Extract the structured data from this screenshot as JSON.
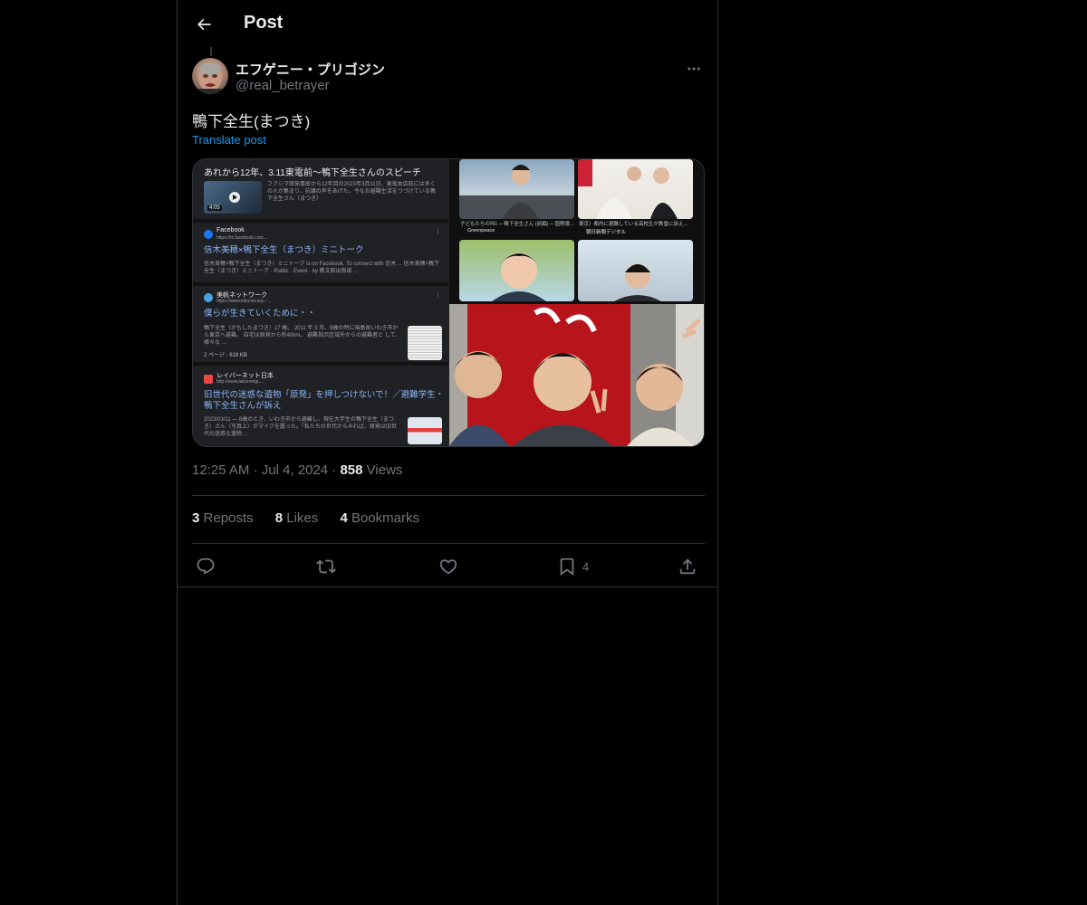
{
  "header": {
    "title": "Post",
    "back_icon": "arrow-left-icon"
  },
  "author": {
    "display_name": "エフゲニー・プリゴジン",
    "handle": "@real_betrayer"
  },
  "post": {
    "text": "鴨下全生(まつき)",
    "translate_label": "Translate post",
    "time": "12:25 AM",
    "date": "Jul 4, 2024",
    "views_count": "858",
    "views_label": "Views"
  },
  "media": {
    "results": [
      {
        "title": "あれから12年、3.11東電前〜鴨下全生さんのスピーチ",
        "snippet": "フクシマ原発事故から12年目の2023年3月11日、東電本店前には多くの人が集まり、抗議の声をあげた。今なお避難生活をつづけている鴨下全生さん（まつき）",
        "duration": "4:05"
      },
      {
        "site": "Facebook",
        "url": "https://m.facebook.com...",
        "link": "信木美穂×鴨下全生（まつき）ミニトーク",
        "snippet": "信木美穂×鴨下全生（まつき）ミニトーク is on Facebook. To connect with 信木 ... 信木美穂×鴨下全生（まつき）ミニトーク · Public · Event · by 教文館出版部 ..."
      },
      {
        "site": "美帆ネットワーク",
        "url": "https://www.kibonet.org › ...",
        "link": "僕らが生きていくために・・",
        "snippet": "鴨下全生（かもしたまつき）17 歳。 2011 年 3 月、8歳の時に福島県いわき市から東京へ避難。 自宅は原発から約40km。 避難指示区域外からの避難者と して、様々な ...",
        "meta": "2 ページ · 619 KB"
      },
      {
        "site": "レイバーネット日本",
        "url": "http://www.labornetjp....",
        "link": "旧世代の迷惑な遺物「原発」を押しつけないで！／避難学生・鴨下全生さんが訴え",
        "snippet": "2023/03/11 — 8歳のとき、いわき市から避難し、現在大学生の鴨下全生（まつき）さん（写真上）がマイクを握った。「私たちの世代からみれば、原発は旧世代の迷惑な遺物 ..."
      }
    ],
    "image_captions": [
      {
        "caption": "子どもたちの叫ﾋ ─ 鴨下全生さん (前編) ─ 国際環...",
        "source": "Greenpeace"
      },
      {
        "caption": "東京）都内に避難している高校生が教皇に訴え...",
        "source": "朝日新聞デジタル"
      }
    ]
  },
  "stats": {
    "reposts_count": "3",
    "reposts_label": "Reposts",
    "likes_count": "8",
    "likes_label": "Likes",
    "bookmarks_count": "4",
    "bookmarks_label": "Bookmarks"
  },
  "actions": {
    "reply_icon": "reply-icon",
    "repost_icon": "repost-icon",
    "like_icon": "heart-icon",
    "bookmark_icon": "bookmark-icon",
    "bookmark_count": "4",
    "share_icon": "share-icon"
  },
  "colors": {
    "background": "#000000",
    "text_primary": "#e7e9ea",
    "text_secondary": "#71767b",
    "accent": "#1d9bf0",
    "border": "#2f3336"
  }
}
